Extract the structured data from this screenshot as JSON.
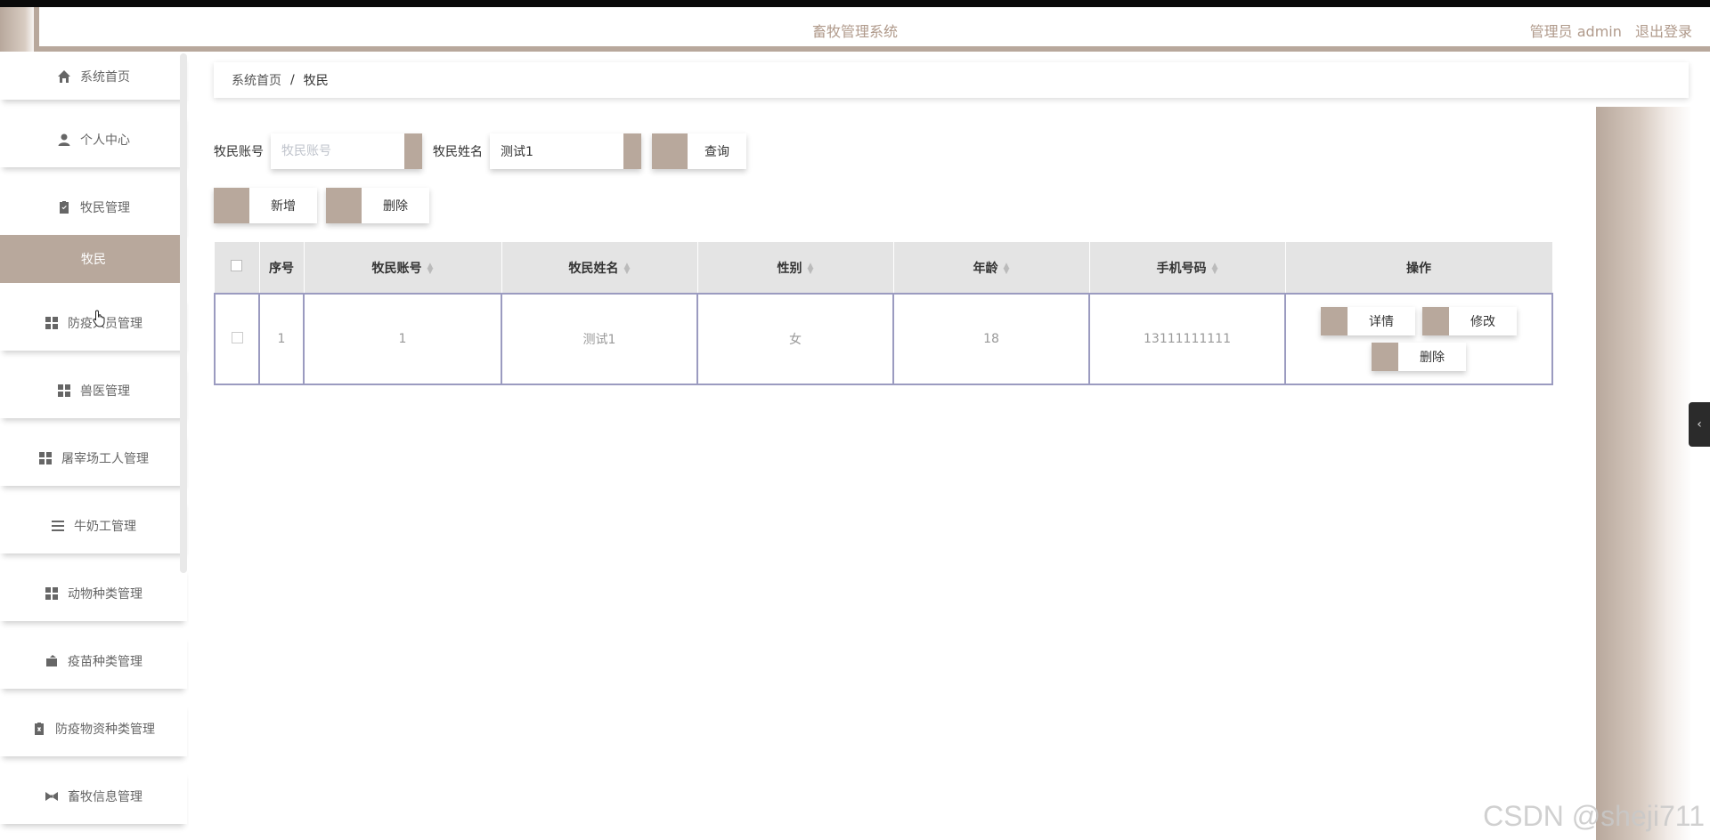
{
  "header": {
    "title": "畜牧管理系统",
    "user_label": "管理员 admin",
    "logout_label": "退出登录"
  },
  "sidebar": {
    "items": [
      {
        "label": "系统首页",
        "icon": "home-icon"
      },
      {
        "label": "个人中心",
        "icon": "user-icon"
      },
      {
        "label": "牧民管理",
        "icon": "clipboard-icon"
      },
      {
        "label": "牧民",
        "icon": ""
      },
      {
        "label": "防疫人员管理",
        "icon": "grid-icon"
      },
      {
        "label": "兽医管理",
        "icon": "grid-icon"
      },
      {
        "label": "屠宰场工人管理",
        "icon": "grid-icon"
      },
      {
        "label": "牛奶工管理",
        "icon": "list-icon"
      },
      {
        "label": "动物种类管理",
        "icon": "grid-icon"
      },
      {
        "label": "疫苗种类管理",
        "icon": "wallet-icon"
      },
      {
        "label": "防疫物资种类管理",
        "icon": "clipboard-x-icon"
      },
      {
        "label": "畜牧信息管理",
        "icon": "bow-icon"
      }
    ]
  },
  "breadcrumb": {
    "home": "系统首页",
    "separator": "/",
    "current": "牧民"
  },
  "search": {
    "account_label": "牧民账号",
    "account_placeholder": "牧民账号",
    "account_value": "",
    "name_label": "牧民姓名",
    "name_value": "测试1",
    "query_label": "查询"
  },
  "actions": {
    "add_label": "新增",
    "delete_label": "删除"
  },
  "table": {
    "headers": [
      "序号",
      "牧民账号",
      "牧民姓名",
      "性别",
      "年龄",
      "手机号码",
      "操作"
    ],
    "rows": [
      {
        "index": "1",
        "account": "1",
        "name": "测试1",
        "gender": "女",
        "age": "18",
        "phone": "13111111111"
      }
    ],
    "op_detail": "详情",
    "op_edit": "修改",
    "op_delete": "删除"
  },
  "watermark": "CSDN @sheji711",
  "colors": {
    "accent": "#b8a89c",
    "header_text": "#b09a8b",
    "table_header_bg": "#e4e4e4",
    "table_border": "#9b9bc0"
  }
}
